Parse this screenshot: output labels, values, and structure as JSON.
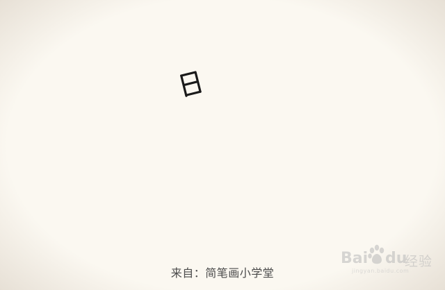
{
  "caption": "来自：简笔画小学堂",
  "drawing": {
    "character": "日",
    "icon": "sun-character-glyph"
  },
  "watermark": {
    "brand_bai": "Bai",
    "brand_du": "du",
    "brand_cn": "经验",
    "url": "jingyan.baidu.com",
    "icon": "baidu-paw-icon"
  },
  "colors": {
    "paper": "#fbf8f1",
    "ink": "#1a1a1a",
    "caption": "#4a4a4a",
    "watermark": "#b9b9b9"
  }
}
